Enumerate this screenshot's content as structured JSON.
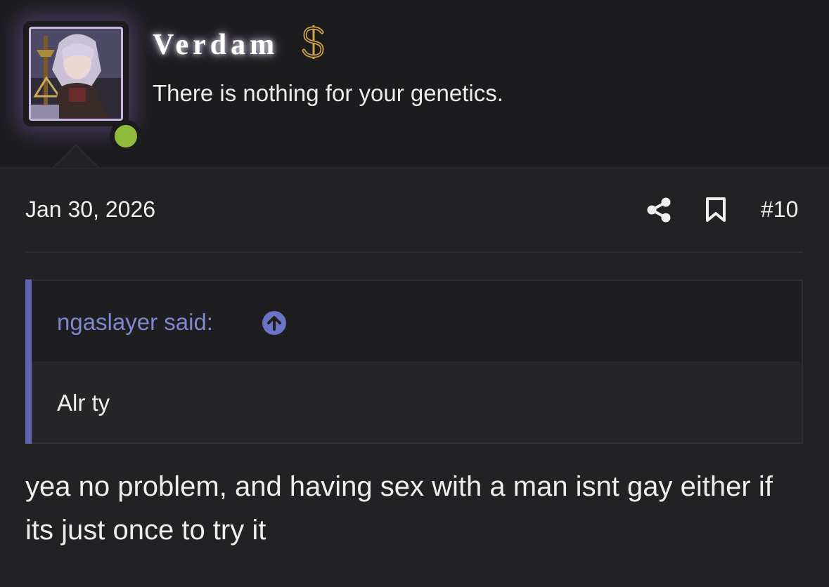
{
  "user": {
    "name": "Verdam",
    "title": "There is nothing for your genetics.",
    "badge_icon": "dollar-sign-icon",
    "status_icon": "online-indicator-icon",
    "status_color": "#8fba3c",
    "name_glow_color": "#d2b4ff"
  },
  "post": {
    "date": "Jan 30, 2026",
    "number": "#10",
    "share_icon": "share-icon",
    "bookmark_icon": "bookmark-icon",
    "body": "yea no problem, and having sex with a man isnt gay either if its just once to try it"
  },
  "quote": {
    "author_label": "ngaslayer said:",
    "jump_icon": "arrow-up-circle-icon",
    "text": "Alr ty",
    "accent_color": "#5f65b2"
  }
}
